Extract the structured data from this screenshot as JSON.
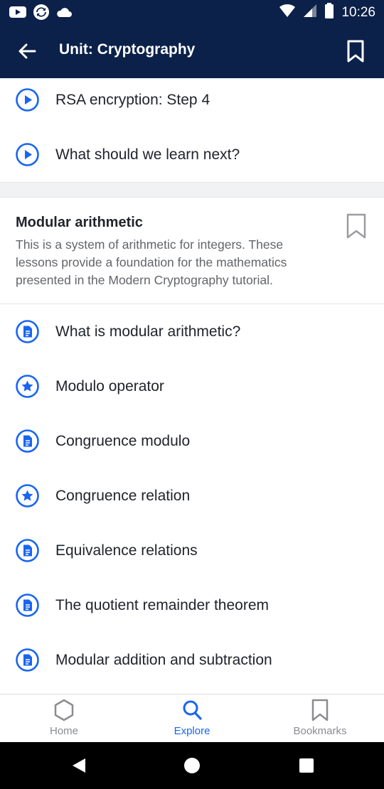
{
  "status_bar": {
    "time": "10:26",
    "left_icons": [
      "youtube-icon",
      "sync-icon",
      "cloud-icon"
    ],
    "right_icons": [
      "wifi-icon",
      "signal-icon",
      "battery-icon"
    ]
  },
  "app_bar": {
    "title": "Unit: Cryptography",
    "back_icon": "arrow-left-icon",
    "bookmark_icon": "bookmark-outline-icon",
    "background": "#0b2149"
  },
  "previous_items": [
    {
      "label": "RSA encryption: Step 4",
      "icon": "play-circle-icon"
    },
    {
      "label": "What should we learn next?",
      "icon": "play-circle-icon"
    }
  ],
  "section": {
    "title": "Modular arithmetic",
    "description": "This is a system of arithmetic for integers. These lessons provide a foundation for the mathematics presented in the Modern Cryptography tutorial.",
    "bookmark_icon": "bookmark-outline-icon",
    "items": [
      {
        "label": "What is modular arithmetic?",
        "icon": "article-icon"
      },
      {
        "label": "Modulo operator",
        "icon": "star-circle-icon"
      },
      {
        "label": "Congruence modulo",
        "icon": "article-icon"
      },
      {
        "label": "Congruence relation",
        "icon": "star-circle-icon"
      },
      {
        "label": "Equivalence relations",
        "icon": "article-icon"
      },
      {
        "label": "The quotient remainder theorem",
        "icon": "article-icon"
      },
      {
        "label": "Modular addition and subtraction",
        "icon": "article-icon"
      }
    ]
  },
  "bottom_nav": {
    "items": [
      {
        "label": "Home",
        "icon": "hexagon-icon",
        "active": false
      },
      {
        "label": "Explore",
        "icon": "search-icon",
        "active": true
      },
      {
        "label": "Bookmarks",
        "icon": "bookmark-icon",
        "active": false
      }
    ]
  },
  "colors": {
    "accent": "#1865f2",
    "header": "#0b2149",
    "text": "#21242c",
    "muted": "#626569"
  }
}
